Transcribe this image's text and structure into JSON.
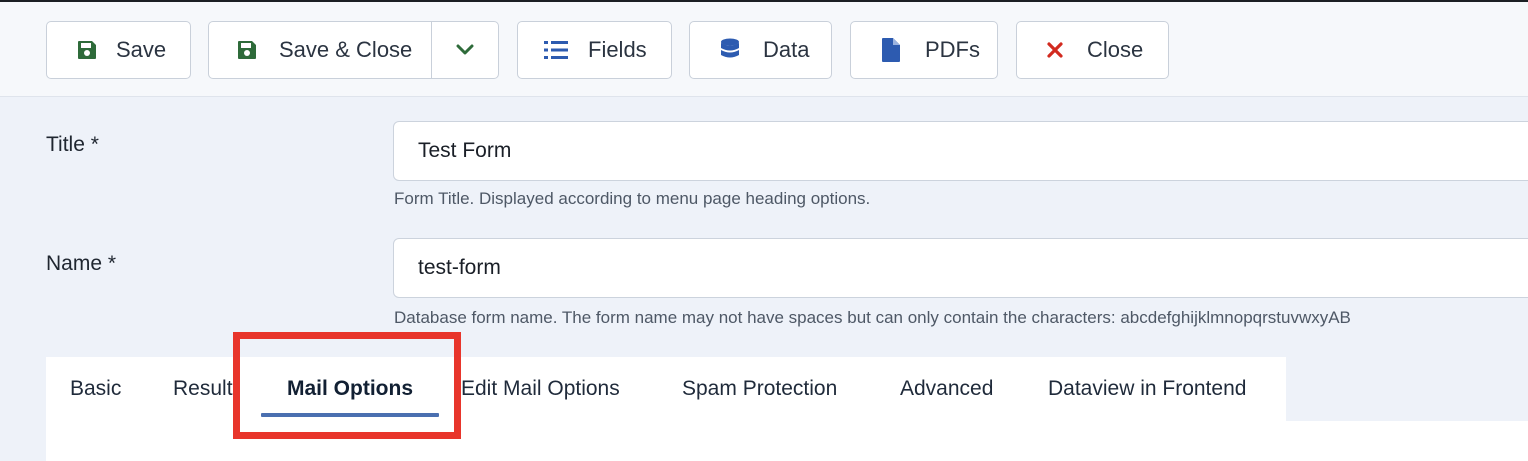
{
  "toolbar": {
    "save_label": "Save",
    "save_close_label": "Save & Close",
    "fields_label": "Fields",
    "data_label": "Data",
    "pdfs_label": "PDFs",
    "close_label": "Close"
  },
  "form": {
    "title_label": "Title *",
    "title_value": "Test Form",
    "title_help": "Form Title. Displayed according to menu page heading options.",
    "name_label": "Name *",
    "name_value": "test-form",
    "name_help": "Database form name. The form name may not have spaces but can only contain the characters: abcdefghijklmnopqrstuvwxyAB"
  },
  "tabs": [
    {
      "label": "Basic"
    },
    {
      "label": "Result"
    },
    {
      "label": "Mail Options"
    },
    {
      "label": "Edit Mail Options"
    },
    {
      "label": "Spam Protection"
    },
    {
      "label": "Advanced"
    },
    {
      "label": "Dataview in Frontend"
    }
  ],
  "active_tab": "Mail Options",
  "colors": {
    "save_icon": "#2e6b3a",
    "list_icon": "#2d5bb0",
    "close_icon": "#d22a1f",
    "highlight": "#e8352b",
    "tab_underline": "#4a6fb0"
  }
}
